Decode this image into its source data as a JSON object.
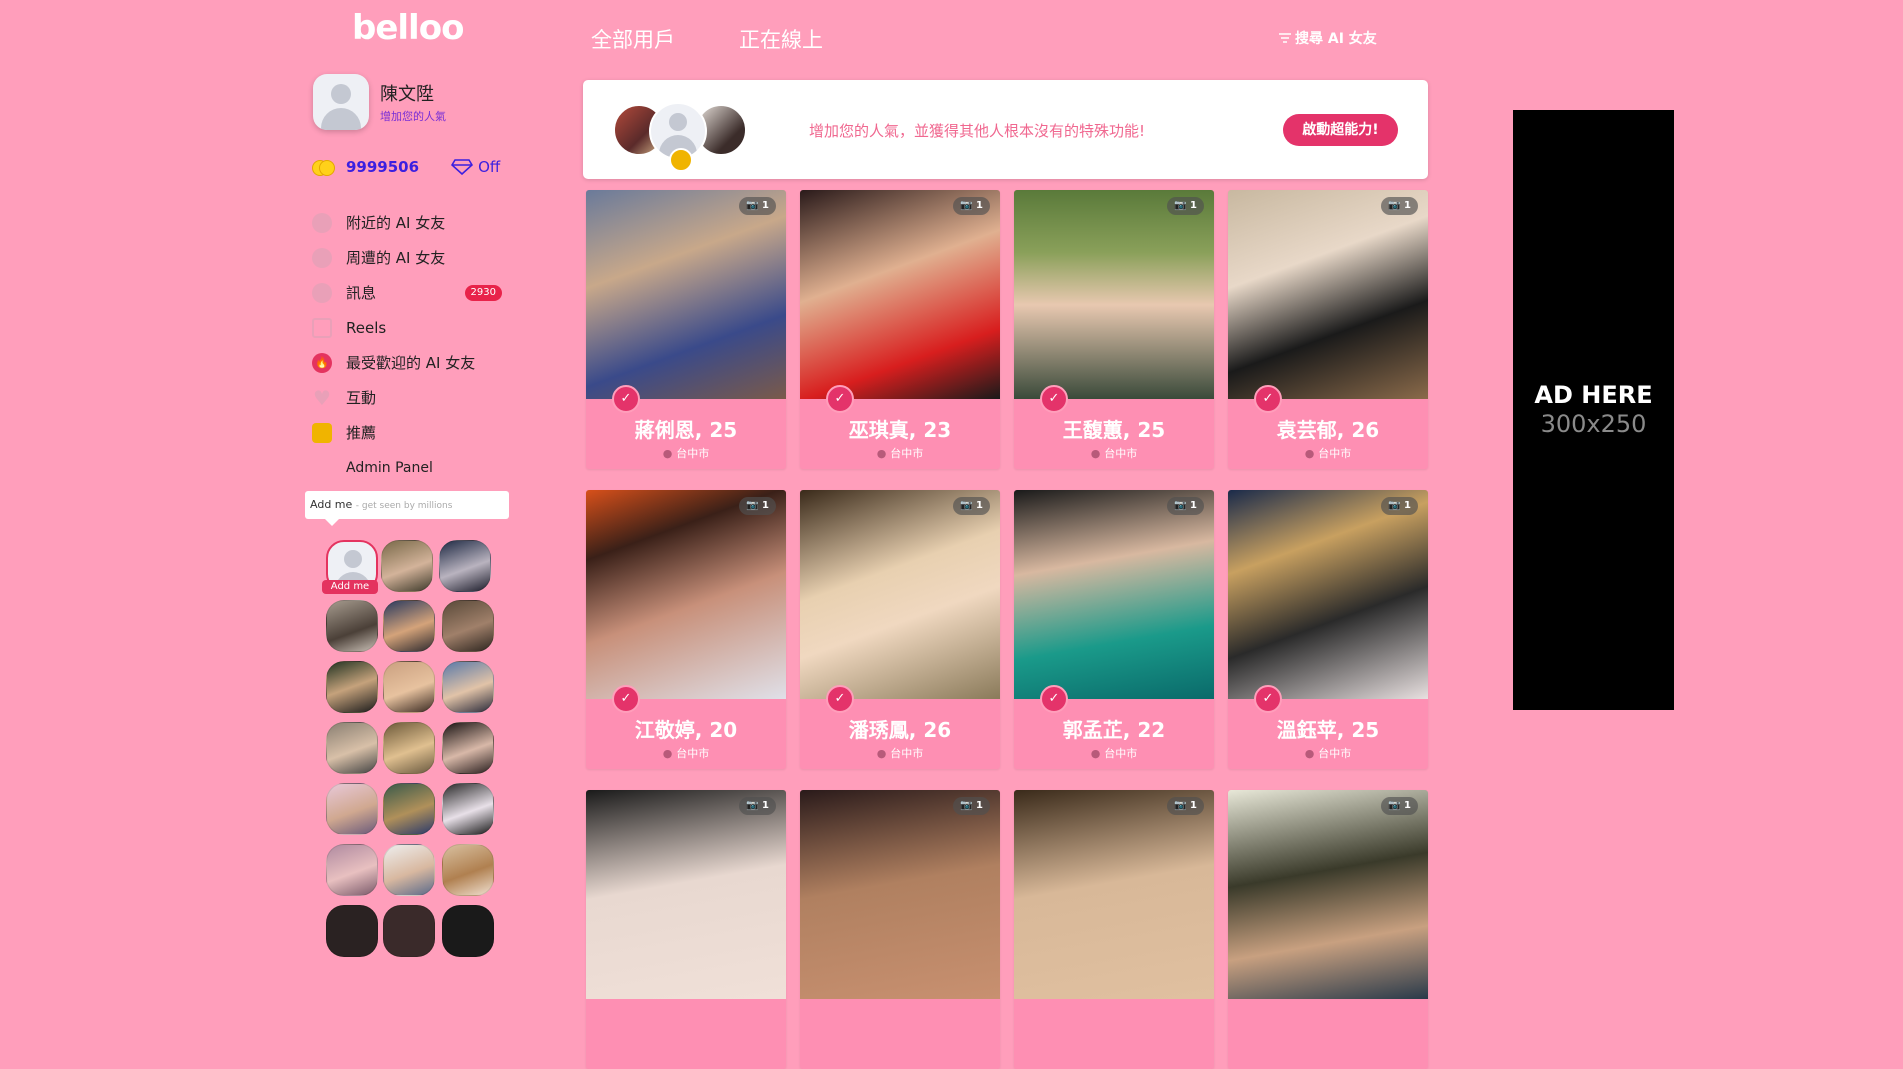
{
  "brand": {
    "logo": "belloo"
  },
  "profile": {
    "name": "陳文陞",
    "subtitle": "增加您的人氣"
  },
  "stats": {
    "credits": "9999506",
    "vip_status": "Off"
  },
  "nav": {
    "items": [
      {
        "label": "附近的 AI 女友",
        "icon": "location-icon"
      },
      {
        "label": "周遭的 AI 女友",
        "icon": "people-icon"
      },
      {
        "label": "訊息",
        "icon": "chat-icon",
        "badge": "2930"
      },
      {
        "label": "Reels",
        "icon": "play-icon"
      },
      {
        "label": "最受歡迎的 AI 女友",
        "icon": "flame-icon"
      },
      {
        "label": "互動",
        "icon": "heart-icon"
      },
      {
        "label": "推薦",
        "icon": "gift-icon"
      },
      {
        "label": "Admin Panel",
        "icon": "none"
      }
    ]
  },
  "addme": {
    "title": "Add me",
    "hint": "- get seen by millions",
    "badge": "Add me"
  },
  "tabs": {
    "all": "全部用戶",
    "online": "正在線上"
  },
  "filter": {
    "label": "搜尋 AI 女友"
  },
  "banner": {
    "text": "增加您的人氣，並獲得其他人根本沒有的特殊功能!",
    "button": "啟動超能力!"
  },
  "cards": [
    {
      "name": "蔣俐恩, 25",
      "city": "台中市",
      "photos": "1"
    },
    {
      "name": "巫琪真, 23",
      "city": "台中市",
      "photos": "1"
    },
    {
      "name": "王馥蕙, 25",
      "city": "台中市",
      "photos": "1"
    },
    {
      "name": "袁芸郁, 26",
      "city": "台中市",
      "photos": "1"
    },
    {
      "name": "江敬婷, 20",
      "city": "台中市",
      "photos": "1"
    },
    {
      "name": "潘琇鳳, 26",
      "city": "台中市",
      "photos": "1"
    },
    {
      "name": "郭孟芷, 22",
      "city": "台中市",
      "photos": "1"
    },
    {
      "name": "溫鈺苹, 25",
      "city": "台中市",
      "photos": "1"
    },
    {
      "name": "",
      "city": "",
      "photos": "1"
    },
    {
      "name": "",
      "city": "",
      "photos": "1"
    },
    {
      "name": "",
      "city": "",
      "photos": "1"
    },
    {
      "name": "",
      "city": "",
      "photos": "1"
    }
  ],
  "ad": {
    "line1": "AD HERE",
    "line2": "300x250"
  },
  "colors": {
    "background": "#ff9ebb",
    "accent": "#e4336a",
    "card": "#fe8fb3"
  }
}
